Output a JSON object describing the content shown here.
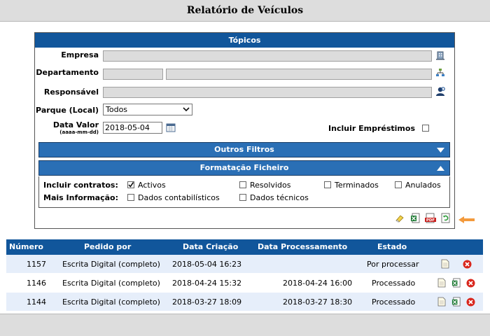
{
  "header": {
    "title": "Relatório de Veículos"
  },
  "form": {
    "section_title": "Tópicos",
    "empresa_label": "Empresa",
    "departamento_label": "Departamento",
    "responsavel_label": "Responsável",
    "parque_label": "Parque (Local)",
    "parque_value": "Todos",
    "data_valor_label": "Data Valor",
    "data_valor_format": "(aaaa-mm-dd)",
    "data_valor_value": "2018-05-04",
    "incluir_emprestimos_label": "Incluir Empréstimos",
    "outros_filtros": "Outros Filtros",
    "formatacao": "Formatação Ficheiro",
    "incluir_contratos_label": "Incluir contratos:",
    "activos": "Activos",
    "resolvidos": "Resolvidos",
    "terminados": "Terminados",
    "anulados": "Anulados",
    "mais_info_label": "Mais Informação:",
    "dados_contabilisticos": "Dados contabilísticos",
    "dados_tecnicos": "Dados técnicos"
  },
  "table": {
    "columns": [
      "Número",
      "Pedido por",
      "Data Criação",
      "Data Processamento",
      "Estado"
    ],
    "rows": [
      {
        "numero": "1157",
        "pedido": "Escrita Digital (completo)",
        "criacao": "2018-05-04 16:23",
        "processamento": "",
        "estado": "Por processar"
      },
      {
        "numero": "1146",
        "pedido": "Escrita Digital (completo)",
        "criacao": "2018-04-24 15:32",
        "processamento": "2018-04-24 16:00",
        "estado": "Processado"
      },
      {
        "numero": "1144",
        "pedido": "Escrita Digital (completo)",
        "criacao": "2018-03-27 18:09",
        "processamento": "2018-03-27 18:30",
        "estado": "Processado"
      }
    ]
  },
  "colors": {
    "header_blue": "#11569b",
    "bar_blue": "#2a6fb5",
    "row_alt": "#e6eefa",
    "delete_red": "#d9261c",
    "arrow_orange": "#f39a3c"
  }
}
